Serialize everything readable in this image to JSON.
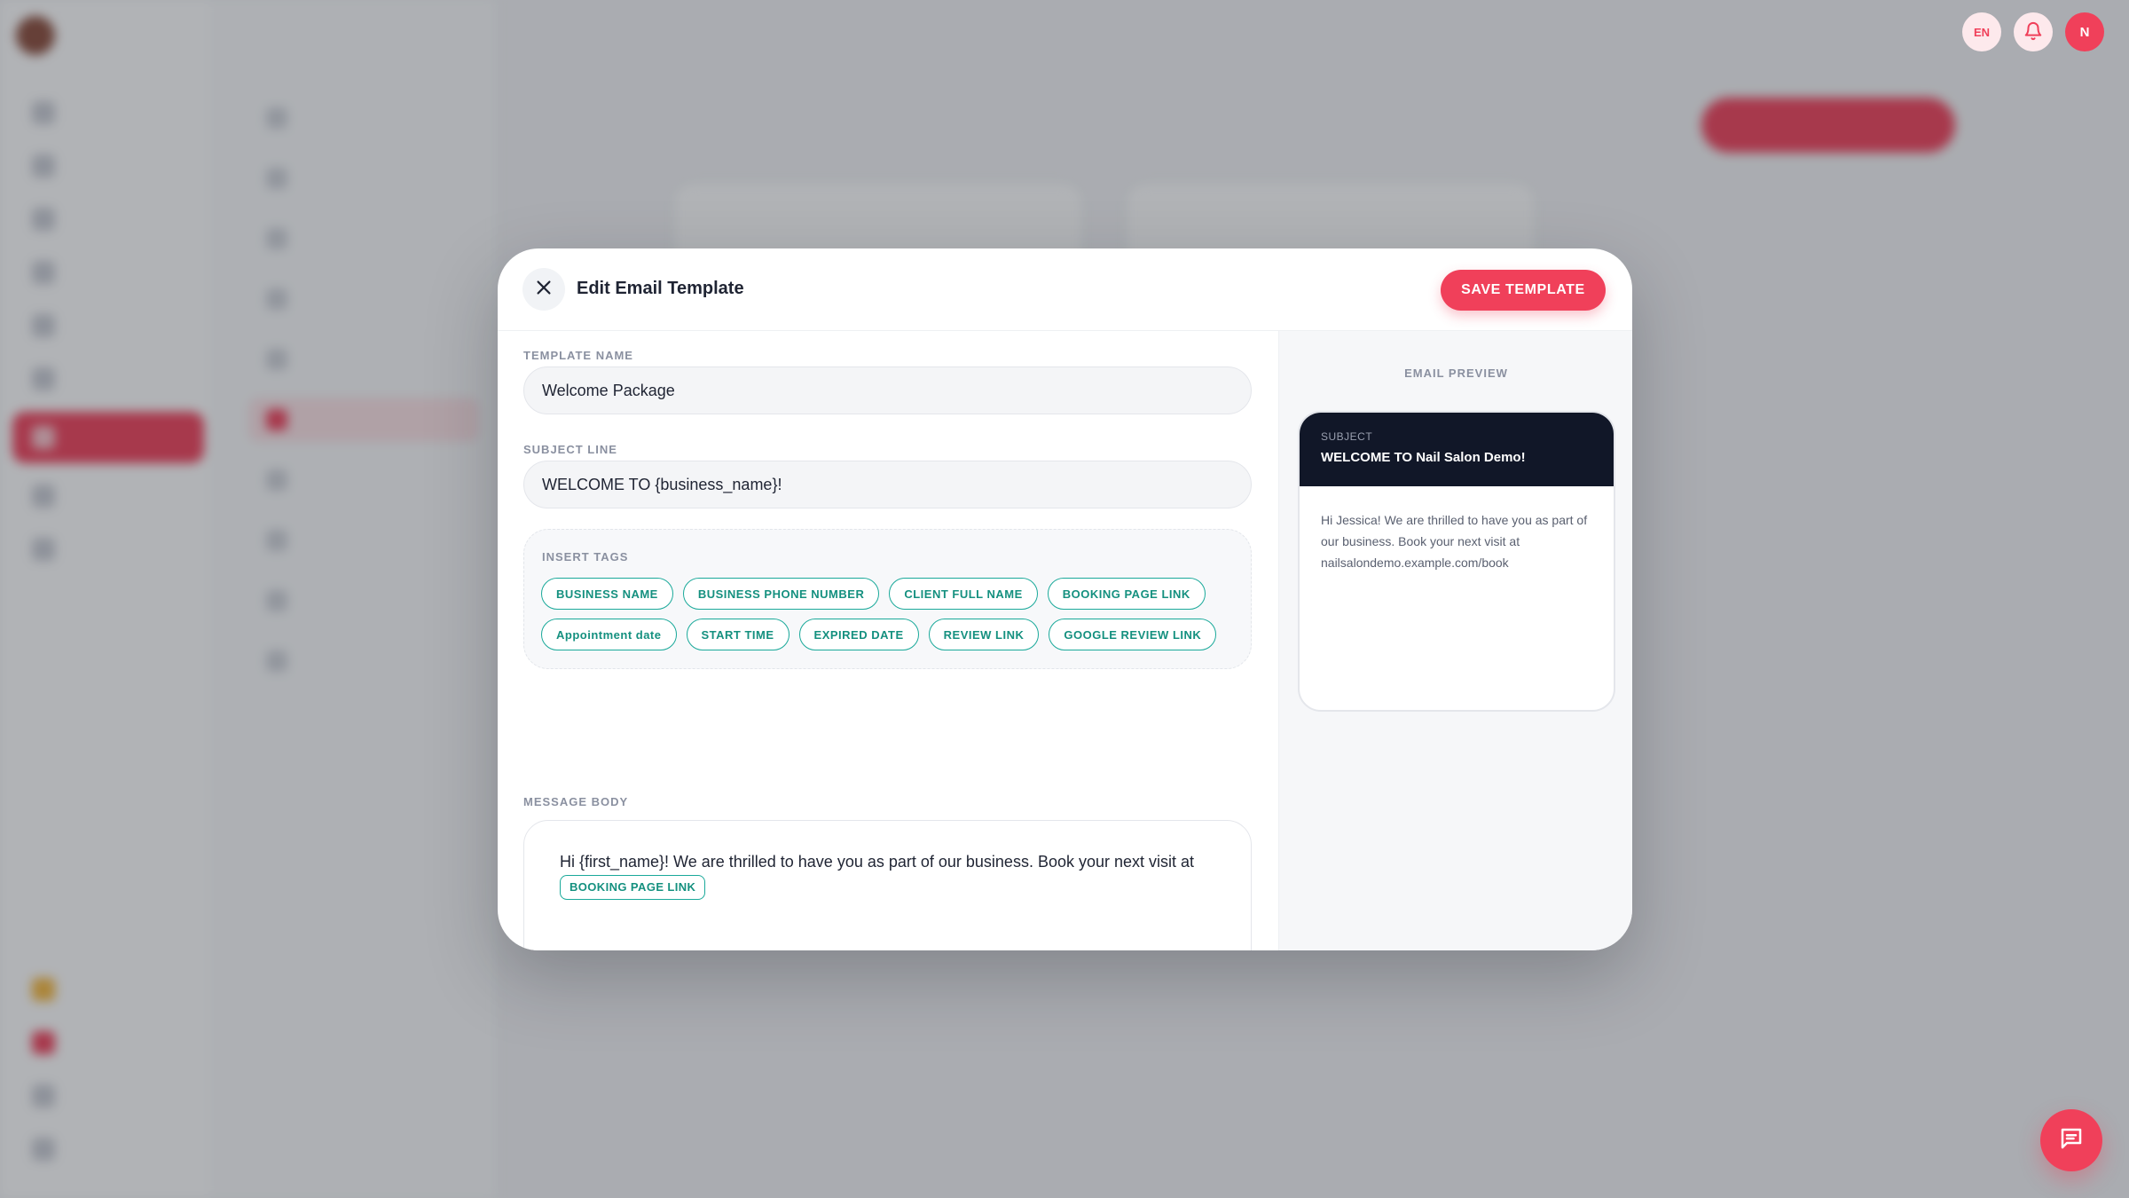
{
  "colors": {
    "accent": "#f0405a",
    "tag": "#1aa99a",
    "preview_header": "#111728"
  },
  "topbar": {
    "language": "EN",
    "avatar_initial": "N"
  },
  "modal": {
    "title": "Edit Email Template",
    "save_label": "SAVE TEMPLATE",
    "template_name": {
      "label": "TEMPLATE NAME",
      "value": "Welcome Package"
    },
    "subject_line": {
      "label": "SUBJECT LINE",
      "value": "WELCOME TO {business_name}!"
    },
    "insert_tags": {
      "label": "INSERT TAGS",
      "tags": [
        "BUSINESS NAME",
        "BUSINESS PHONE NUMBER",
        "CLIENT FULL NAME",
        "BOOKING PAGE LINK",
        "Appointment date",
        "START TIME",
        "EXPIRED DATE",
        "REVIEW LINK",
        "GOOGLE REVIEW LINK"
      ]
    },
    "message_body": {
      "label": "MESSAGE BODY",
      "text": "Hi {first_name}! We are thrilled to have you as part of our business. Book your next visit at",
      "inline_tag": "BOOKING PAGE LINK"
    }
  },
  "preview": {
    "label": "EMAIL PREVIEW",
    "subject_label": "SUBJECT",
    "subject": "WELCOME TO Nail Salon Demo!",
    "body": "Hi Jessica! We are thrilled to have you as part of our business. Book your next visit at nailsalondemo.example.com/book"
  },
  "icons": {
    "close": "close-icon",
    "bell": "bell-icon",
    "chat": "chat-icon"
  }
}
